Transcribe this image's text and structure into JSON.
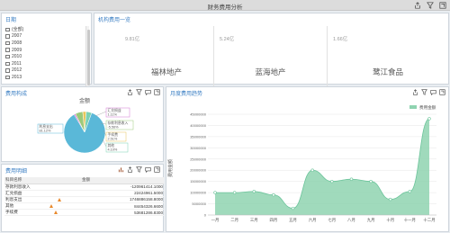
{
  "header": {
    "title": "财务费用分析"
  },
  "date_panel": {
    "title": "日期",
    "items": [
      "(全部)",
      "2007",
      "2008",
      "2009",
      "2010",
      "2011",
      "2012",
      "2013"
    ]
  },
  "org_panel": {
    "title": "机构费用一览",
    "cards": [
      {
        "amount": "9.81亿",
        "name": "福林地产"
      },
      {
        "amount": "5.24亿",
        "name": "蓝海地产"
      },
      {
        "amount": "1.66亿",
        "name": "鹭江食品"
      }
    ]
  },
  "structure_panel": {
    "title": "费用构成",
    "pie_title": "金额",
    "slices": [
      {
        "label": "利息支出",
        "pct_label": "81.12%",
        "pct": 81.12,
        "color": "#5ab8d8"
      },
      {
        "label": "汇兑损益",
        "pct_label": "1.11%",
        "pct": 1.11,
        "color": "#d478d4"
      },
      {
        "label": "存款利息收入",
        "pct_label": "-5.56%",
        "pct": 5.56,
        "color": "#9bc97a"
      },
      {
        "label": "手续费",
        "pct_label": "2.51%",
        "pct": 2.51,
        "color": "#e8c65a"
      },
      {
        "label": "其他",
        "pct_label": "4.10%",
        "pct": 4.1,
        "color": "#7ad1b4"
      }
    ]
  },
  "detail_panel": {
    "title": "费用明细",
    "columns": [
      "科目名称",
      "金额"
    ],
    "rows": [
      {
        "name": "存款利息收入",
        "amount": "-120961414.1000",
        "warn": false
      },
      {
        "name": "汇兑损益",
        "amount": "22424961.5000",
        "warn": false
      },
      {
        "name": "利息支出",
        "amount": "1746886158.8000",
        "warn": true
      },
      {
        "name": "其他",
        "amount": "84454326.6600",
        "warn": true
      },
      {
        "name": "手续费",
        "amount": "53681286.8300",
        "warn": true
      }
    ]
  },
  "trend_panel": {
    "title": "月度费用趋势",
    "legend": "费用金额",
    "ylabel": "费用金额",
    "color": "#8fd3b0"
  },
  "chart_data": {
    "type": "area",
    "title": "",
    "xlabel": "",
    "ylabel": "费用金额",
    "categories": [
      "一月",
      "二月",
      "三月",
      "四月",
      "五月",
      "六月",
      "七月",
      "八月",
      "九月",
      "十月",
      "十一月",
      "十二月"
    ],
    "series": [
      {
        "name": "费用金额",
        "values": [
          10000000,
          10000000,
          10500000,
          9000000,
          3000000,
          20000000,
          15000000,
          16000000,
          15000000,
          7000000,
          10500000,
          43000000
        ]
      }
    ],
    "ylim": [
      0,
      45000000
    ],
    "yticks": [
      "0",
      "5000000",
      "10000000",
      "15000000",
      "20000000",
      "25000000",
      "30000000",
      "35000000",
      "40000000",
      "45000000"
    ],
    "grid": true,
    "legend_position": "top-right"
  }
}
